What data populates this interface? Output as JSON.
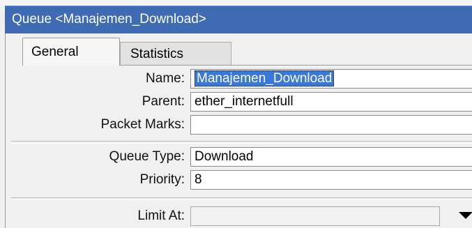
{
  "window": {
    "title": "Queue <Manajemen_Download>"
  },
  "tabs": [
    {
      "label": "General",
      "active": true
    },
    {
      "label": "Statistics",
      "active": false
    }
  ],
  "form": {
    "name": {
      "label": "Name:",
      "value": "Manajemen_Download"
    },
    "parent": {
      "label": "Parent:",
      "value": "ether_internetfull"
    },
    "packet_marks": {
      "label": "Packet Marks:",
      "value": ""
    },
    "queue_type": {
      "label": "Queue Type:",
      "value": "Download"
    },
    "priority": {
      "label": "Priority:",
      "value": "8"
    },
    "limit_at": {
      "label": "Limit At:",
      "value": ""
    }
  },
  "colors": {
    "titlebar": "#3f6bb5",
    "selection": "#3778d8"
  },
  "icons": {
    "limit_at_dropdown": "triangle-down-icon"
  }
}
